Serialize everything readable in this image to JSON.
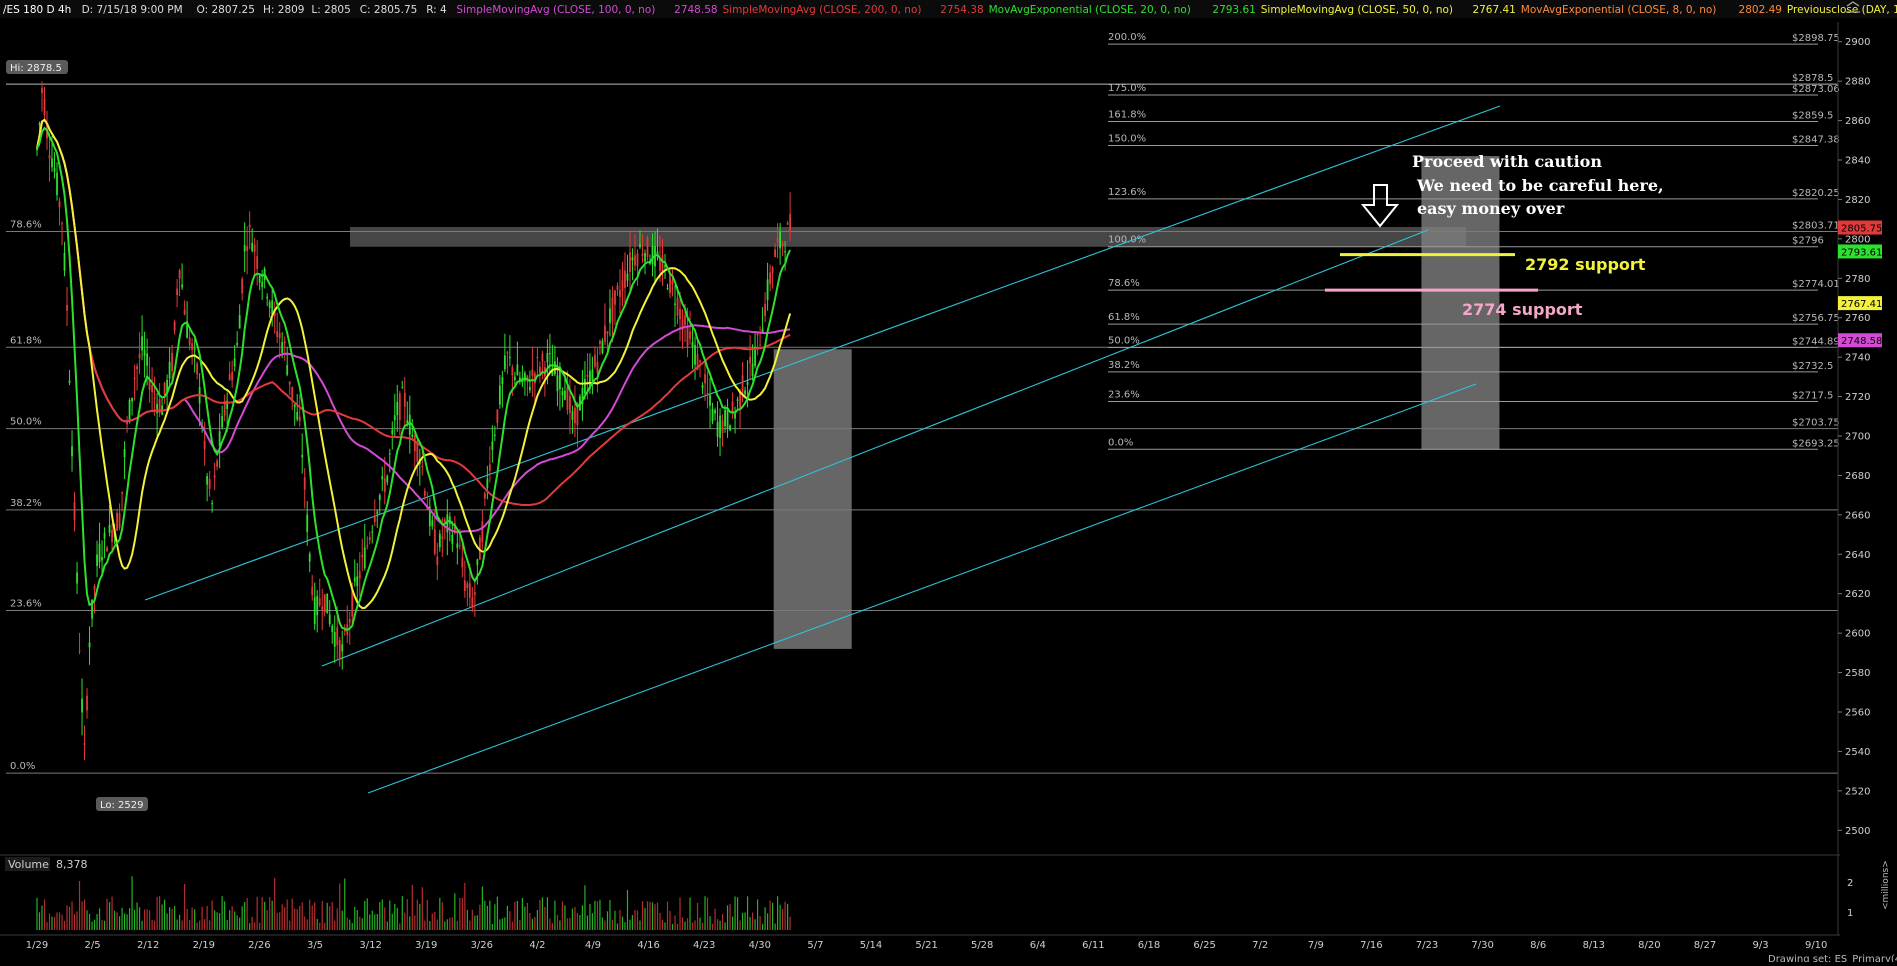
{
  "header": {
    "symbol": "/ES 180 D 4h",
    "datetime": "D: 7/15/18 9:00 PM",
    "open": "O: 2807.25",
    "high": "H: 2809",
    "low": "L: 2805",
    "close": "C: 2805.75",
    "r": "R: 4",
    "studies": [
      {
        "label": "SimpleMovingAvg (CLOSE, 100, 0, no)",
        "value": "2748.58",
        "color": "#d34bd3"
      },
      {
        "label": "SimpleMovingAvg (CLOSE, 200, 0, no)",
        "value": "2754.38",
        "color": "#e23a3a"
      },
      {
        "label": "MovAvgExponential (CLOSE, 20, 0, no)",
        "value": "2793.61",
        "color": "#2ee02e"
      },
      {
        "label": "SimpleMovingAvg (CLOSE, 50, 0, no)",
        "value": "2767.41",
        "color": "#f2f23a"
      },
      {
        "label": "MovAvgExponential (CLOSE, 8, 0, no)",
        "value": "2802.49",
        "color": "#ff8a3a"
      },
      {
        "label": "Previousclose (DAY, 1, -1,...",
        "value": "",
        "color": "#f2f23a"
      }
    ]
  },
  "hi_label": "Hi: 2878.5",
  "lo_label": "Lo: 2529",
  "volume_label": "Volume",
  "volume_value": "8,378",
  "volume_unit": "<millions>",
  "footer_text": "Drawing set: ES_Primary(4)",
  "colors": {
    "sma100": "#d34bd3",
    "sma200": "#e23a3a",
    "ema20": "#2ee02e",
    "sma50": "#f2f23a",
    "channel": "#2cc6d6",
    "candle_up": "#2ee02e",
    "candle_down": "#e23a3a",
    "support_2792": "#f2f23a",
    "support_2774": "#f4a6c8",
    "zone": "#808080"
  },
  "annotations": {
    "caution_1": "Proceed with caution",
    "caution_2": "We need to be careful here,",
    "caution_3": "easy money over",
    "support_2792": "2792 support",
    "support_2774": "2774 support"
  },
  "chart_data": {
    "type": "candlestick",
    "instrument": "/ES",
    "timeframe": "4h",
    "ylim": [
      2490,
      2910
    ],
    "y_ticks": [
      2500,
      2520,
      2540,
      2560,
      2580,
      2600,
      2620,
      2640,
      2660,
      2680,
      2700,
      2720,
      2740,
      2760,
      2780,
      2800,
      2820,
      2840,
      2860,
      2880,
      2900
    ],
    "x_ticks": [
      "1/29",
      "2/5",
      "2/12",
      "2/19",
      "2/26",
      "3/5",
      "3/12",
      "3/19",
      "3/26",
      "4/2",
      "4/9",
      "4/16",
      "4/23",
      "4/30",
      "5/7",
      "5/14",
      "5/21",
      "5/28",
      "6/4",
      "6/11",
      "6/18",
      "6/25",
      "7/2",
      "7/9",
      "7/16",
      "7/23",
      "7/30",
      "8/6",
      "8/13",
      "8/20",
      "8/27",
      "9/3",
      "9/10"
    ],
    "price_path": [
      [
        0,
        2845
      ],
      [
        0.05,
        2860
      ],
      [
        0.1,
        2879
      ],
      [
        0.2,
        2850
      ],
      [
        0.3,
        2838
      ],
      [
        0.45,
        2810
      ],
      [
        0.55,
        2760
      ],
      [
        0.7,
        2640
      ],
      [
        0.85,
        2535
      ],
      [
        0.95,
        2600
      ],
      [
        1.1,
        2640
      ],
      [
        1.3,
        2650
      ],
      [
        1.5,
        2660
      ],
      [
        1.6,
        2700
      ],
      [
        1.75,
        2730
      ],
      [
        1.9,
        2745
      ],
      [
        2.1,
        2720
      ],
      [
        2.25,
        2715
      ],
      [
        2.45,
        2740
      ],
      [
        2.55,
        2790
      ],
      [
        2.7,
        2755
      ],
      [
        2.9,
        2730
      ],
      [
        3.05,
        2680
      ],
      [
        3.15,
        2665
      ],
      [
        3.3,
        2700
      ],
      [
        3.45,
        2725
      ],
      [
        3.6,
        2745
      ],
      [
        3.75,
        2800
      ],
      [
        3.85,
        2803
      ],
      [
        4.0,
        2785
      ],
      [
        4.15,
        2775
      ],
      [
        4.3,
        2755
      ],
      [
        4.45,
        2745
      ],
      [
        4.6,
        2720
      ],
      [
        4.75,
        2700
      ],
      [
        4.9,
        2640
      ],
      [
        5.0,
        2610
      ],
      [
        5.15,
        2620
      ],
      [
        5.35,
        2600
      ],
      [
        5.5,
        2590
      ],
      [
        5.7,
        2620
      ],
      [
        5.9,
        2640
      ],
      [
        6.1,
        2665
      ],
      [
        6.3,
        2680
      ],
      [
        6.45,
        2710
      ],
      [
        6.6,
        2720
      ],
      [
        6.75,
        2700
      ],
      [
        6.9,
        2690
      ],
      [
        7.05,
        2660
      ],
      [
        7.2,
        2640
      ],
      [
        7.35,
        2655
      ],
      [
        7.55,
        2650
      ],
      [
        7.7,
        2625
      ],
      [
        7.85,
        2615
      ],
      [
        8.0,
        2650
      ],
      [
        8.15,
        2690
      ],
      [
        8.3,
        2715
      ],
      [
        8.45,
        2740
      ],
      [
        8.6,
        2732
      ],
      [
        8.8,
        2725
      ],
      [
        9.0,
        2735
      ],
      [
        9.2,
        2738
      ],
      [
        9.35,
        2730
      ],
      [
        9.5,
        2725
      ],
      [
        9.65,
        2705
      ],
      [
        9.8,
        2720
      ],
      [
        9.95,
        2730
      ],
      [
        10.1,
        2740
      ],
      [
        10.3,
        2760
      ],
      [
        10.5,
        2775
      ],
      [
        10.7,
        2790
      ],
      [
        10.9,
        2796
      ],
      [
        11.05,
        2792
      ],
      [
        11.2,
        2788
      ],
      [
        11.35,
        2780
      ],
      [
        11.5,
        2770
      ],
      [
        11.65,
        2755
      ],
      [
        11.8,
        2745
      ],
      [
        11.95,
        2732
      ],
      [
        12.1,
        2715
      ],
      [
        12.25,
        2705
      ],
      [
        12.4,
        2708
      ],
      [
        12.55,
        2712
      ],
      [
        12.7,
        2725
      ],
      [
        12.85,
        2735
      ],
      [
        13.0,
        2750
      ],
      [
        13.15,
        2775
      ],
      [
        13.3,
        2795
      ],
      [
        13.45,
        2800
      ],
      [
        13.55,
        2806
      ]
    ],
    "fibonacci_right": [
      {
        "level": "0.0%",
        "price": 2693.25
      },
      {
        "level": "23.6%",
        "price": 2717.5
      },
      {
        "level": "38.2%",
        "price": 2732.5
      },
      {
        "level": "50.0%",
        "price": 2744.89
      },
      {
        "level": "61.8%",
        "price": 2756.75
      },
      {
        "level": "78.6%",
        "price": 2774.01
      },
      {
        "level": "100.0%",
        "price": 2796
      },
      {
        "level": "123.6%",
        "price": 2820.25
      },
      {
        "level": "150.0%",
        "price": 2847.38
      },
      {
        "level": "161.8%",
        "price": 2859.5
      },
      {
        "level": "175.0%",
        "price": 2873
      },
      {
        "level": "200.0%",
        "price": 2898.75
      }
    ],
    "fibonacci_right_labels": [
      "$2693.25",
      "$2703.75",
      "$2717.5",
      "$2732.5",
      "$2744.89",
      "$2756.75",
      "$2774.01",
      "$2796",
      "$2803.71",
      "$2820.25",
      "$2847.38",
      "$2859.5",
      "$2873.06",
      "$2878.5",
      "$2898.75"
    ],
    "fibonacci_left": [
      {
        "level": "0.0%",
        "price": 2529
      },
      {
        "level": "23.6%",
        "price": 2611.48
      },
      {
        "level": "38.2%",
        "price": 2662.51
      },
      {
        "level": "50.0%",
        "price": 2703.75
      },
      {
        "level": "61.8%",
        "price": 2744.99
      },
      {
        "level": "78.6%",
        "price": 2803.71
      }
    ],
    "price_tags": [
      {
        "value": "2805.75",
        "color": "#e23a3a"
      },
      {
        "value": "2793.61",
        "color": "#2ee02e"
      },
      {
        "value": "2767.41",
        "color": "#f2f23a"
      },
      {
        "value": "2748.58",
        "color": "#d34bd3"
      },
      {
        "value": "2754.38",
        "color": "#e23a3a"
      }
    ],
    "supports": [
      {
        "label": "2792 support",
        "price": 2792
      },
      {
        "label": "2774 support",
        "price": 2774
      }
    ],
    "hi": 2878.5,
    "lo": 2529,
    "volume_ticks": [
      "1",
      "2"
    ]
  }
}
